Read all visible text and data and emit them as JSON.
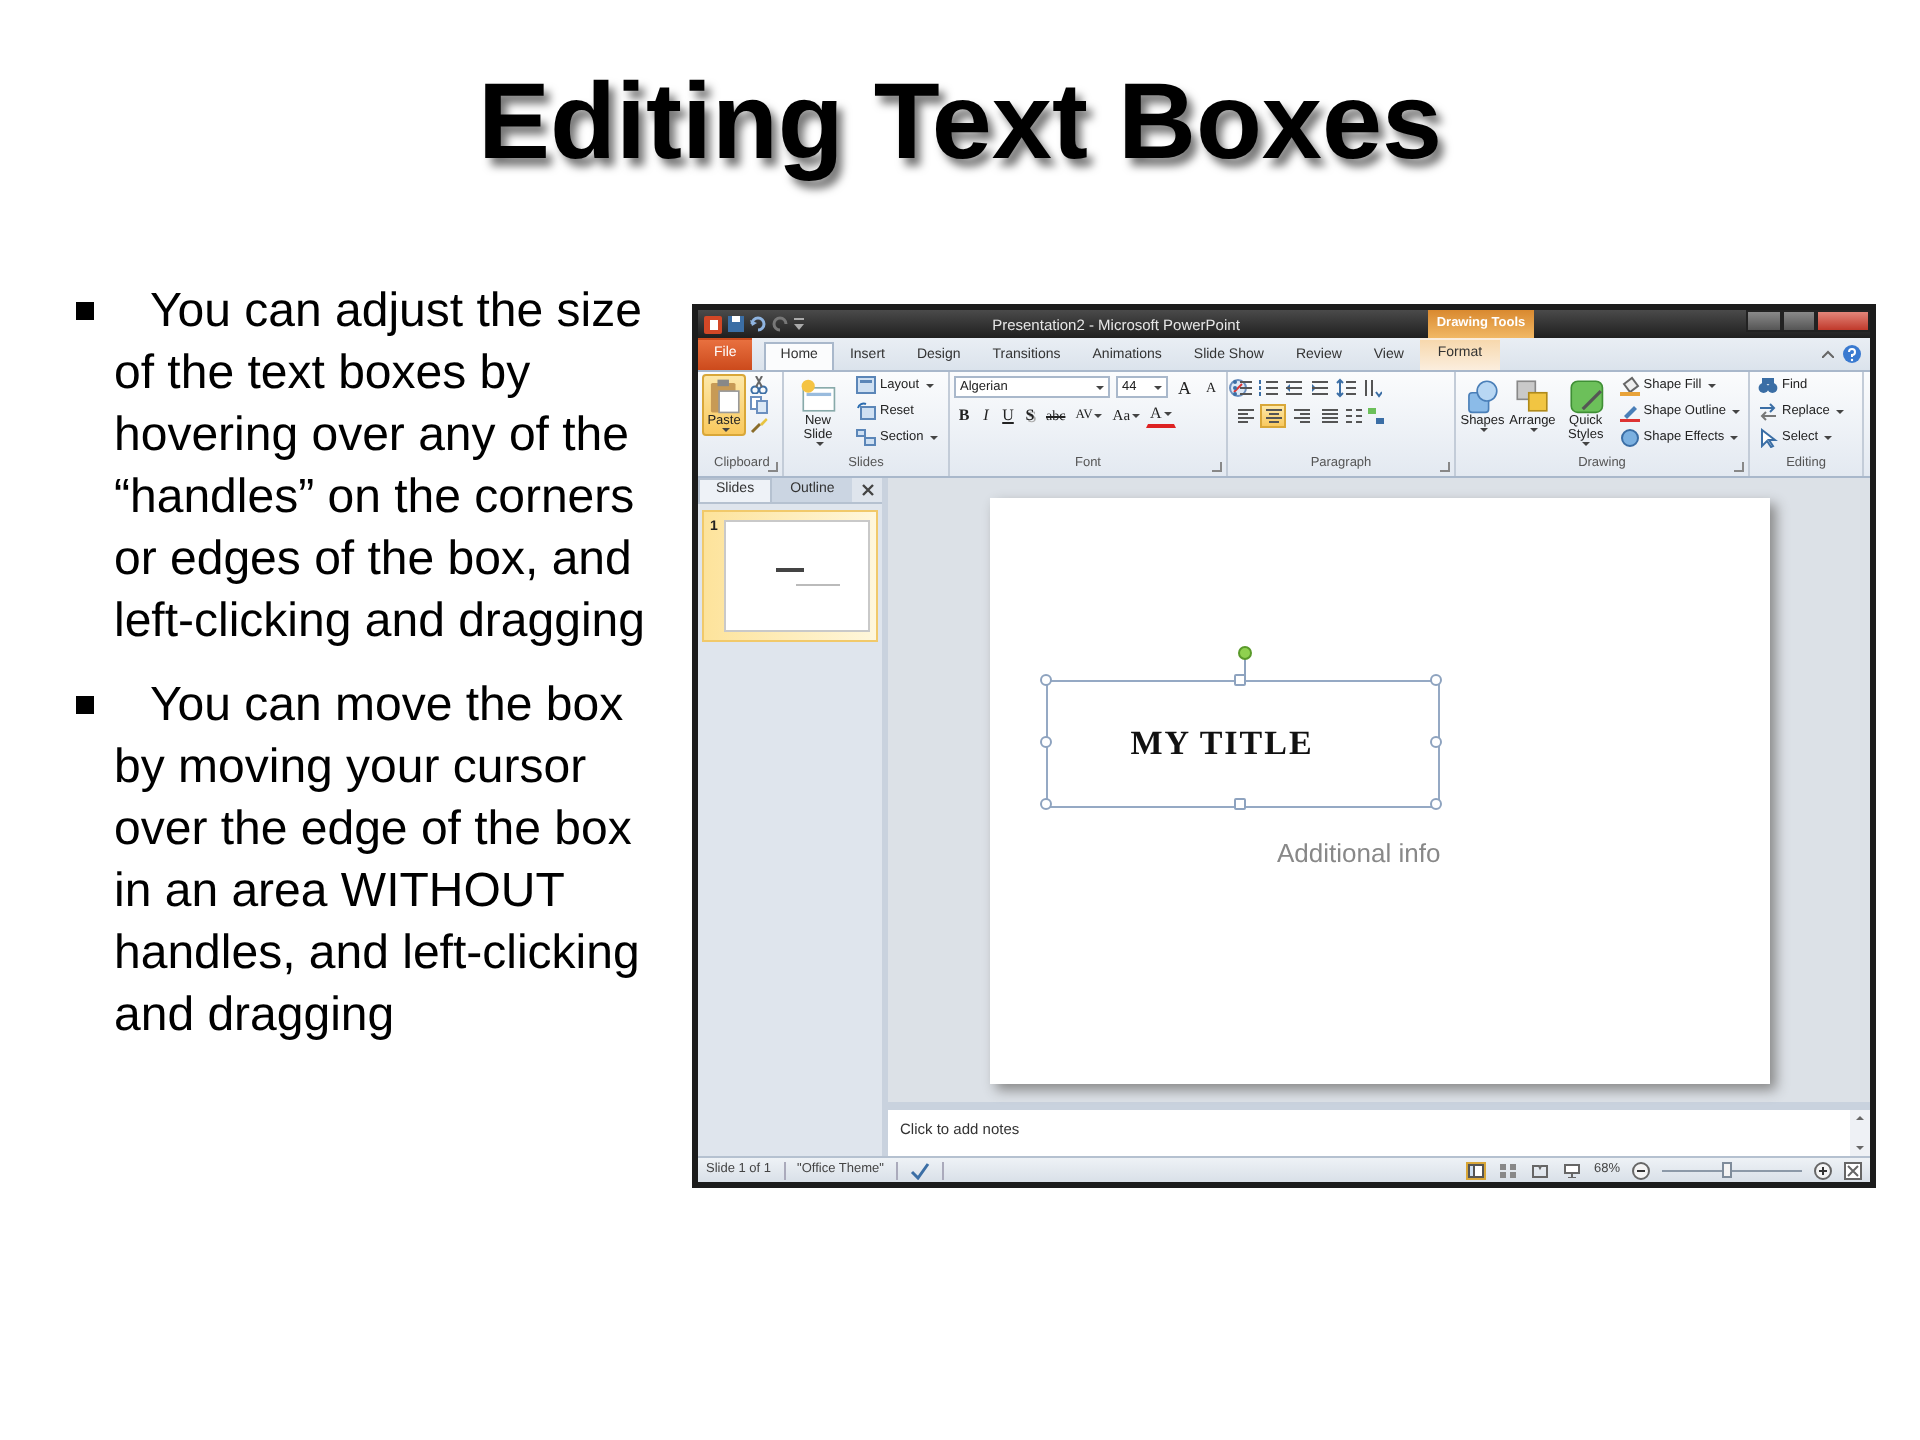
{
  "slide": {
    "title": "Editing Text Boxes",
    "bullets": [
      "You can adjust the size of the text boxes by hovering over any of the “handles” on the corners or edges of the box, and left-clicking and dragging",
      "You can move the box by moving your cursor over the edge of the box in an area WITHOUT handles, and left-clicking and dragging"
    ]
  },
  "app_window": {
    "title": "Presentation2 - Microsoft PowerPoint",
    "contextual_group": "Drawing Tools",
    "tabs": [
      {
        "label": "File",
        "kind": "file",
        "selected": false
      },
      {
        "label": "Home",
        "kind": "normal",
        "selected": true
      },
      {
        "label": "Insert",
        "kind": "normal",
        "selected": false
      },
      {
        "label": "Design",
        "kind": "normal",
        "selected": false
      },
      {
        "label": "Transitions",
        "kind": "normal",
        "selected": false
      },
      {
        "label": "Animations",
        "kind": "normal",
        "selected": false
      },
      {
        "label": "Slide Show",
        "kind": "normal",
        "selected": false
      },
      {
        "label": "Review",
        "kind": "normal",
        "selected": false
      },
      {
        "label": "View",
        "kind": "normal",
        "selected": false
      },
      {
        "label": "Format",
        "kind": "contextual",
        "selected": false
      }
    ],
    "ribbon": [
      {
        "name": "Clipboard",
        "launcher": true,
        "buttons": [
          {
            "label": "Paste",
            "kind": "large",
            "dropdown": true,
            "highlighted": true
          }
        ]
      },
      {
        "name": "Slides",
        "launcher": false,
        "buttons": [
          {
            "label": "New Slide",
            "kind": "large",
            "dropdown": true,
            "highlighted": false
          },
          {
            "label": "Layout",
            "kind": "small",
            "dropdown": true,
            "highlighted": false
          },
          {
            "label": "Reset",
            "kind": "small",
            "dropdown": false,
            "highlighted": false
          },
          {
            "label": "Section",
            "kind": "small",
            "dropdown": true,
            "highlighted": false
          }
        ]
      },
      {
        "name": "Font",
        "launcher": true,
        "font_name": "Algerian",
        "font_size": "44",
        "size_buttons": [
          "A",
          "A"
        ],
        "format_buttons": [
          "B",
          "I",
          "U",
          "S",
          "abc",
          "AV",
          "Aa",
          "A"
        ]
      },
      {
        "name": "Paragraph",
        "launcher": true,
        "alignment_buttons": [
          {
            "selected": false
          },
          {
            "selected": true
          },
          {
            "selected": false
          },
          {
            "selected": false
          }
        ]
      },
      {
        "name": "Drawing",
        "launcher": true,
        "buttons": [
          {
            "label": "Shapes",
            "kind": "large",
            "dropdown": true,
            "highlighted": false
          },
          {
            "label": "Arrange",
            "kind": "large",
            "dropdown": true,
            "highlighted": false
          },
          {
            "label": "Quick Styles",
            "kind": "large",
            "dropdown": true,
            "highlighted": false
          },
          {
            "label": "Shape Fill",
            "kind": "small",
            "dropdown": true,
            "highlighted": false
          },
          {
            "label": "Shape Outline",
            "kind": "small",
            "dropdown": true,
            "highlighted": false
          },
          {
            "label": "Shape Effects",
            "kind": "small",
            "dropdown": true,
            "highlighted": false
          }
        ]
      },
      {
        "name": "Editing",
        "launcher": false,
        "buttons": [
          {
            "label": "Find",
            "kind": "small",
            "dropdown": false,
            "highlighted": false
          },
          {
            "label": "Replace",
            "kind": "small",
            "dropdown": true,
            "highlighted": false
          },
          {
            "label": "Select",
            "kind": "small",
            "dropdown": true,
            "highlighted": false
          }
        ]
      }
    ],
    "panel_tabs": [
      {
        "label": "Slides",
        "selected": true
      },
      {
        "label": "Outline",
        "selected": false
      }
    ],
    "thumbnails": [
      {
        "number": "1",
        "selected": true
      }
    ],
    "slide": {
      "title": "MY TITLE",
      "subtitle": "Additional info",
      "title_selected": true
    },
    "notes": {
      "placeholder": "Click to add notes"
    },
    "status_bar": {
      "slide_info": "Slide 1 of 1",
      "theme": "\"Office Theme\"",
      "views": [
        {
          "selected": true
        },
        {
          "selected": false
        },
        {
          "selected": false
        },
        {
          "selected": false
        }
      ],
      "zoom": "68%",
      "zoom_slider": {
        "level": 0.45
      }
    }
  }
}
